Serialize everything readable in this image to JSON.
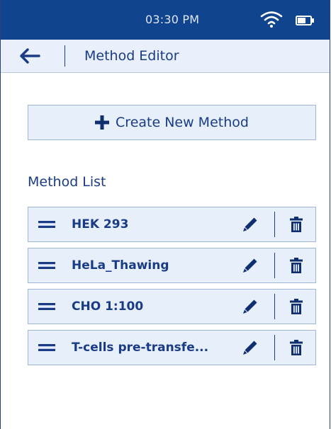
{
  "status_bar": {
    "time": "03:30 PM",
    "icons": [
      "wifi-icon",
      "battery-icon"
    ]
  },
  "header": {
    "title": "Method Editor",
    "back_icon": "back-arrow-icon"
  },
  "create_button": {
    "label": "Create New Method",
    "icon": "plus-icon"
  },
  "method_list": {
    "title": "Method List",
    "items": [
      {
        "name": "HEK 293"
      },
      {
        "name": "HeLa_Thawing"
      },
      {
        "name": "CHO 1:100"
      },
      {
        "name": "T-cells pre-transfe..."
      }
    ],
    "item_icons": [
      "drag-handle-icon",
      "pencil-icon",
      "trash-icon"
    ]
  },
  "colors": {
    "status_bar": "#11448f",
    "header_bg": "#e9f0fb",
    "primary_text": "#1a3b86",
    "item_bg": "#e7effa",
    "item_border": "#9fb6d9"
  }
}
